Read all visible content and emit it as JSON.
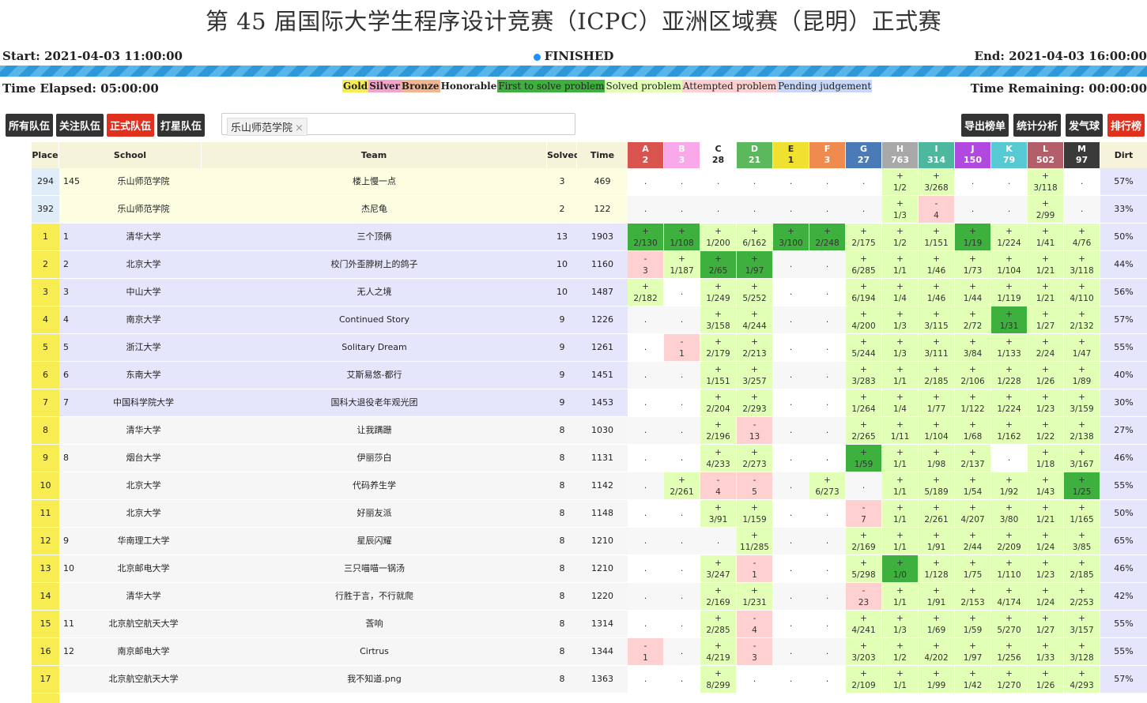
{
  "title": "第 45 届国际大学生程序设计竞赛（ICPC）亚洲区域赛（昆明）正式赛",
  "status": {
    "start": "Start: 2021-04-03 11:00:00",
    "end": "End: 2021-04-03 16:00:00",
    "state": "FINISHED",
    "elapsed": "Time Elapsed: 05:00:00",
    "remaining": "Time Remaining: 00:00:00"
  },
  "legend": [
    {
      "label": "Gold",
      "bg": "#f7ed53"
    },
    {
      "label": "Silver",
      "bg": "#f3a3c9"
    },
    {
      "label": "Bronze",
      "bg": "#f1b592"
    },
    {
      "label": "Honorable",
      "bg": "#ffffff"
    },
    {
      "label": "First to solve problem",
      "bg": "#3db03d"
    },
    {
      "label": "Solved problem",
      "bg": "#e1ffb5"
    },
    {
      "label": "Attempted problem",
      "bg": "#ffd0d0"
    },
    {
      "label": "Pending judgement",
      "bg": "#c8d6fa"
    }
  ],
  "buttons_left": [
    {
      "label": "所有队伍",
      "style": "dark"
    },
    {
      "label": "关注队伍",
      "style": "dark"
    },
    {
      "label": "正式队伍",
      "style": "red"
    },
    {
      "label": "打星队伍",
      "style": "dark"
    }
  ],
  "filter_chip": "乐山师范学院",
  "buttons_right": [
    {
      "label": "导出榜单",
      "style": "dark"
    },
    {
      "label": "统计分析",
      "style": "dark"
    },
    {
      "label": "发气球",
      "style": "dark"
    },
    {
      "label": "排行榜",
      "style": "red"
    }
  ],
  "columns": {
    "place": "Place",
    "school": "School",
    "team": "Team",
    "solved": "Solved",
    "time": "Time",
    "dirt": "Dirt"
  },
  "problems": [
    {
      "id": "A",
      "count": "2",
      "color": "#d9534f"
    },
    {
      "id": "B",
      "count": "3",
      "color": "#f9a8ea"
    },
    {
      "id": "C",
      "count": "28",
      "color": "#ffffff"
    },
    {
      "id": "D",
      "count": "21",
      "color": "#5cb85c"
    },
    {
      "id": "E",
      "count": "1",
      "color": "#f0e130"
    },
    {
      "id": "F",
      "count": "3",
      "color": "#ef8b4e"
    },
    {
      "id": "G",
      "count": "27",
      "color": "#4a7bb7"
    },
    {
      "id": "H",
      "count": "763",
      "color": "#a8a8a8"
    },
    {
      "id": "I",
      "count": "314",
      "color": "#4db89e"
    },
    {
      "id": "J",
      "count": "150",
      "color": "#b148e0"
    },
    {
      "id": "K",
      "count": "79",
      "color": "#56c9d2"
    },
    {
      "id": "L",
      "count": "502",
      "color": "#b25f6a"
    },
    {
      "id": "M",
      "count": "97",
      "color": "#3a3a3a"
    }
  ],
  "rows": [
    {
      "place": "294",
      "rank": "145",
      "school": "乐山师范学院",
      "team": "楼上慢一点",
      "solved": "3",
      "time": "469",
      "dirt": "57%",
      "type": "follow",
      "cells": [
        ".",
        ".",
        ".",
        ".",
        ".",
        ".",
        ".",
        "+|1/2",
        "+|3/268",
        ".",
        ".",
        "+|3/118",
        "."
      ]
    },
    {
      "place": "392",
      "rank": "",
      "school": "乐山师范学院",
      "team": "杰尼龟",
      "solved": "2",
      "time": "122",
      "dirt": "33%",
      "type": "follow",
      "cells": [
        ".",
        ".",
        ".",
        ".",
        ".",
        ".",
        ".",
        "+|1/3",
        "-|4",
        ".",
        ".",
        "+|2/99",
        "."
      ]
    },
    {
      "place": "1",
      "rank": "1",
      "school": "清华大学",
      "team": "三个顶俩",
      "solved": "13",
      "time": "1903",
      "dirt": "50%",
      "type": "gold",
      "cells": [
        "F|2/130",
        "F|1/108",
        "+|1/200",
        "+|6/162",
        "F|3/100",
        "F|2/248",
        "+|2/175",
        "+|1/2",
        "+|1/151",
        "F|1/19",
        "+|1/224",
        "+|1/41",
        "+|4/76"
      ]
    },
    {
      "place": "2",
      "rank": "2",
      "school": "北京大学",
      "team": "校门外歪脖树上的鸽子",
      "solved": "10",
      "time": "1160",
      "dirt": "44%",
      "type": "gold",
      "cells": [
        "-|3",
        "+|1/187",
        "F|2/65",
        "F|1/97",
        ".",
        ".",
        "+|6/285",
        "+|1/1",
        "+|1/46",
        "+|1/73",
        "+|1/104",
        "+|1/21",
        "+|3/118"
      ]
    },
    {
      "place": "3",
      "rank": "3",
      "school": "中山大学",
      "team": "无人之境",
      "solved": "10",
      "time": "1487",
      "dirt": "56%",
      "type": "gold",
      "cells": [
        "+|2/182",
        ".",
        "+|1/249",
        "+|5/252",
        ".",
        ".",
        "+|6/194",
        "+|1/4",
        "+|1/46",
        "+|1/44",
        "+|1/119",
        "+|1/21",
        "+|4/110"
      ]
    },
    {
      "place": "4",
      "rank": "4",
      "school": "南京大学",
      "team": "Continued Story",
      "solved": "9",
      "time": "1226",
      "dirt": "57%",
      "type": "gold",
      "cells": [
        ".",
        ".",
        "+|3/158",
        "+|4/244",
        ".",
        ".",
        "+|4/200",
        "+|1/3",
        "+|3/115",
        "+|2/72",
        "F|1/31",
        "+|1/27",
        "+|2/132"
      ]
    },
    {
      "place": "5",
      "rank": "5",
      "school": "浙江大学",
      "team": "Solitary Dream",
      "solved": "9",
      "time": "1261",
      "dirt": "55%",
      "type": "gold",
      "cells": [
        ".",
        "-|1",
        "+|2/179",
        "+|2/213",
        ".",
        ".",
        "+|5/244",
        "+|1/3",
        "+|3/111",
        "+|3/84",
        "+|1/133",
        "+|2/24",
        "+|1/47"
      ]
    },
    {
      "place": "6",
      "rank": "6",
      "school": "东南大学",
      "team": "艾斯易悠-都行",
      "solved": "9",
      "time": "1451",
      "dirt": "40%",
      "type": "gold",
      "cells": [
        ".",
        ".",
        "+|1/151",
        "+|3/257",
        ".",
        ".",
        "+|3/283",
        "+|1/1",
        "+|2/185",
        "+|2/106",
        "+|1/228",
        "+|1/26",
        "+|1/89"
      ]
    },
    {
      "place": "7",
      "rank": "7",
      "school": "中国科学院大学",
      "team": "国科大退役老年观光团",
      "solved": "9",
      "time": "1453",
      "dirt": "30%",
      "type": "gold",
      "cells": [
        ".",
        ".",
        "+|2/204",
        "+|2/293",
        ".",
        ".",
        "+|1/264",
        "+|1/4",
        "+|1/77",
        "+|1/122",
        "+|1/224",
        "+|1/23",
        "+|3/159"
      ]
    },
    {
      "place": "8",
      "rank": "",
      "school": "清华大学",
      "team": "让我蹒跚",
      "solved": "8",
      "time": "1030",
      "dirt": "27%",
      "type": "star",
      "cells": [
        ".",
        ".",
        "+|2/196",
        "-|13",
        ".",
        ".",
        "+|2/265",
        "+|1/11",
        "+|1/104",
        "+|1/68",
        "+|1/162",
        "+|1/22",
        "+|2/138"
      ]
    },
    {
      "place": "9",
      "rank": "8",
      "school": "烟台大学",
      "team": "伊丽莎白",
      "solved": "8",
      "time": "1131",
      "dirt": "46%",
      "type": "star",
      "cells": [
        ".",
        ".",
        "+|4/233",
        "+|2/273",
        ".",
        ".",
        "F|1/59",
        "+|1/1",
        "+|1/98",
        "+|2/137",
        ".",
        "+|1/18",
        "+|3/167"
      ]
    },
    {
      "place": "10",
      "rank": "",
      "school": "北京大学",
      "team": "代码养生学",
      "solved": "8",
      "time": "1142",
      "dirt": "55%",
      "type": "star",
      "cells": [
        ".",
        "+|2/261",
        "-|4",
        "-|5",
        ".",
        "+|6/273",
        ".",
        "+|1/1",
        "+|5/189",
        "+|1/54",
        "+|1/92",
        "+|1/43",
        "F|1/25"
      ]
    },
    {
      "place": "11",
      "rank": "",
      "school": "北京大学",
      "team": "好丽友派",
      "solved": "8",
      "time": "1148",
      "dirt": "50%",
      "type": "star",
      "cells": [
        ".",
        ".",
        "+|3/91",
        "+|1/159",
        ".",
        ".",
        "-|7",
        "+|1/1",
        "+|2/261",
        "+|4/207",
        "+|3/80",
        "+|1/21",
        "+|1/165"
      ]
    },
    {
      "place": "12",
      "rank": "9",
      "school": "华南理工大学",
      "team": "星辰闪耀",
      "solved": "8",
      "time": "1210",
      "dirt": "65%",
      "type": "star",
      "cells": [
        ".",
        ".",
        ".",
        "+|11/285",
        ".",
        ".",
        "+|2/169",
        "+|1/1",
        "+|1/91",
        "+|2/44",
        "+|2/209",
        "+|1/24",
        "+|3/85"
      ]
    },
    {
      "place": "13",
      "rank": "10",
      "school": "北京邮电大学",
      "team": "三只喵喵一锅汤",
      "solved": "8",
      "time": "1210",
      "dirt": "46%",
      "type": "star",
      "cells": [
        ".",
        ".",
        "+|3/247",
        "-|1",
        ".",
        ".",
        "+|5/298",
        "F|1/0",
        "+|1/128",
        "+|1/75",
        "+|1/110",
        "+|1/23",
        "+|2/185"
      ]
    },
    {
      "place": "14",
      "rank": "",
      "school": "清华大学",
      "team": "行胜于言，不行就爬",
      "solved": "8",
      "time": "1220",
      "dirt": "42%",
      "type": "star",
      "cells": [
        ".",
        ".",
        "+|2/169",
        "+|1/231",
        ".",
        ".",
        "-|23",
        "+|1/1",
        "+|1/91",
        "+|2/153",
        "+|4/174",
        "+|1/24",
        "+|2/253"
      ]
    },
    {
      "place": "15",
      "rank": "11",
      "school": "北京航空航天大学",
      "team": "莟响",
      "solved": "8",
      "time": "1314",
      "dirt": "55%",
      "type": "star",
      "cells": [
        ".",
        ".",
        "+|2/285",
        "-|4",
        ".",
        ".",
        "+|4/241",
        "+|1/3",
        "+|1/69",
        "+|1/59",
        "+|5/270",
        "+|1/27",
        "+|3/157"
      ]
    },
    {
      "place": "16",
      "rank": "12",
      "school": "南京邮电大学",
      "team": "Cirtrus",
      "solved": "8",
      "time": "1344",
      "dirt": "55%",
      "type": "star",
      "cells": [
        "-|1",
        ".",
        "+|4/219",
        "-|3",
        ".",
        ".",
        "+|3/203",
        "+|1/2",
        "+|4/202",
        "+|1/97",
        "+|1/256",
        "+|1/33",
        "+|3/128"
      ]
    },
    {
      "place": "17",
      "rank": "",
      "school": "北京航空航天大学",
      "team": "我不知道.png",
      "solved": "8",
      "time": "1363",
      "dirt": "57%",
      "type": "star",
      "cells": [
        ".",
        ".",
        "+|8/299",
        ".",
        ".",
        ".",
        "+|2/109",
        "+|1/1",
        "+|1/99",
        "+|1/42",
        "+|1/270",
        "+|1/26",
        "+|4/293"
      ]
    }
  ]
}
